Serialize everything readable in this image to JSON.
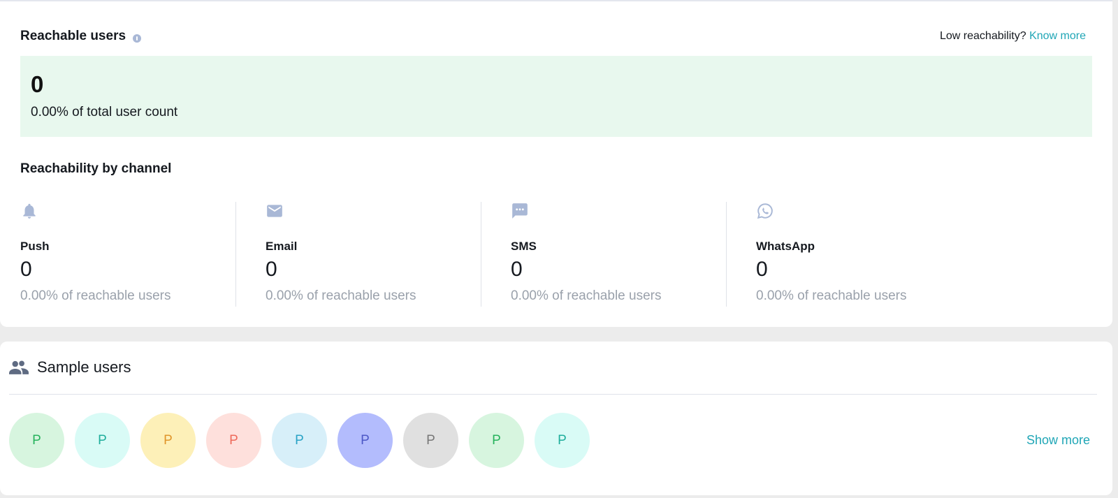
{
  "reachable": {
    "title": "Reachable users",
    "low_reach_text": "Low reachability?",
    "know_more": "Know more",
    "count": "0",
    "total_pct": "0.00% of total user count"
  },
  "channels": {
    "title": "Reachability by channel",
    "items": [
      {
        "name": "Push",
        "count": "0",
        "pct": "0.00% of reachable users",
        "icon": "bell-icon"
      },
      {
        "name": "Email",
        "count": "0",
        "pct": "0.00% of reachable users",
        "icon": "mail-icon"
      },
      {
        "name": "SMS",
        "count": "0",
        "pct": "0.00% of reachable users",
        "icon": "chat-icon"
      },
      {
        "name": "WhatsApp",
        "count": "0",
        "pct": "0.00% of reachable users",
        "icon": "whatsapp-icon"
      }
    ]
  },
  "sample_users": {
    "title": "Sample users",
    "show_more": "Show more",
    "avatars": [
      {
        "initial": "P",
        "bg": "#d7f5df",
        "fg": "#27b35d"
      },
      {
        "initial": "P",
        "bg": "#d9fbf6",
        "fg": "#1fae9c"
      },
      {
        "initial": "P",
        "bg": "#fdf0b8",
        "fg": "#e0962b"
      },
      {
        "initial": "P",
        "bg": "#fee0dc",
        "fg": "#ee6a5b"
      },
      {
        "initial": "P",
        "bg": "#d7eff9",
        "fg": "#2aa3c6"
      },
      {
        "initial": "P",
        "bg": "#b3bcfd",
        "fg": "#4d58c7"
      },
      {
        "initial": "P",
        "bg": "#e0e0e0",
        "fg": "#777777"
      },
      {
        "initial": "P",
        "bg": "#d7f5df",
        "fg": "#27b35d"
      },
      {
        "initial": "P",
        "bg": "#d9fbf6",
        "fg": "#1fae9c"
      }
    ]
  },
  "colors": {
    "accent": "#20a6b6",
    "icon": "#a9b8d6",
    "highlight": "#e8f8ee"
  }
}
